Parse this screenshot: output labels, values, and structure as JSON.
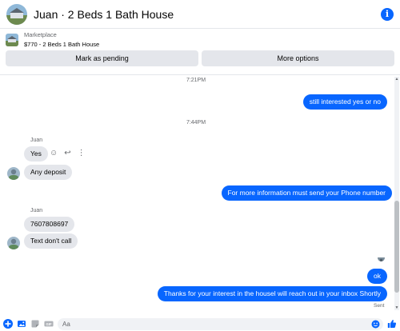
{
  "header": {
    "title": "Juan · 2 Beds 1 Bath House",
    "info_icon": "info-icon"
  },
  "marketplace": {
    "label": "Marketplace",
    "listing": "$770 - 2 Beds 1 Bath House",
    "buttons": {
      "pending": "Mark as pending",
      "more": "More options"
    }
  },
  "thread": {
    "timestamps": [
      "7:21PM",
      "7:44PM"
    ],
    "sender_names": [
      "Juan",
      "Juan"
    ],
    "messages": [
      {
        "text": "still interested yes or no",
        "direction": "out"
      },
      {
        "text": "Yes",
        "direction": "in"
      },
      {
        "text": "Any deposit",
        "direction": "in"
      },
      {
        "text": "For more information must send your Phone number",
        "direction": "out"
      },
      {
        "text": "7607808697",
        "direction": "in"
      },
      {
        "text": "Text don't call",
        "direction": "in"
      },
      {
        "text": "ok",
        "direction": "out"
      },
      {
        "text": "Thanks for your interest in the housel will reach out in your inbox Shortly",
        "direction": "out"
      }
    ],
    "status": "Sent"
  },
  "composer": {
    "placeholder": "Aa"
  },
  "colors": {
    "accent": "#0866ff",
    "bubble_in": "#e4e6eb",
    "muted_text": "#65676b"
  }
}
